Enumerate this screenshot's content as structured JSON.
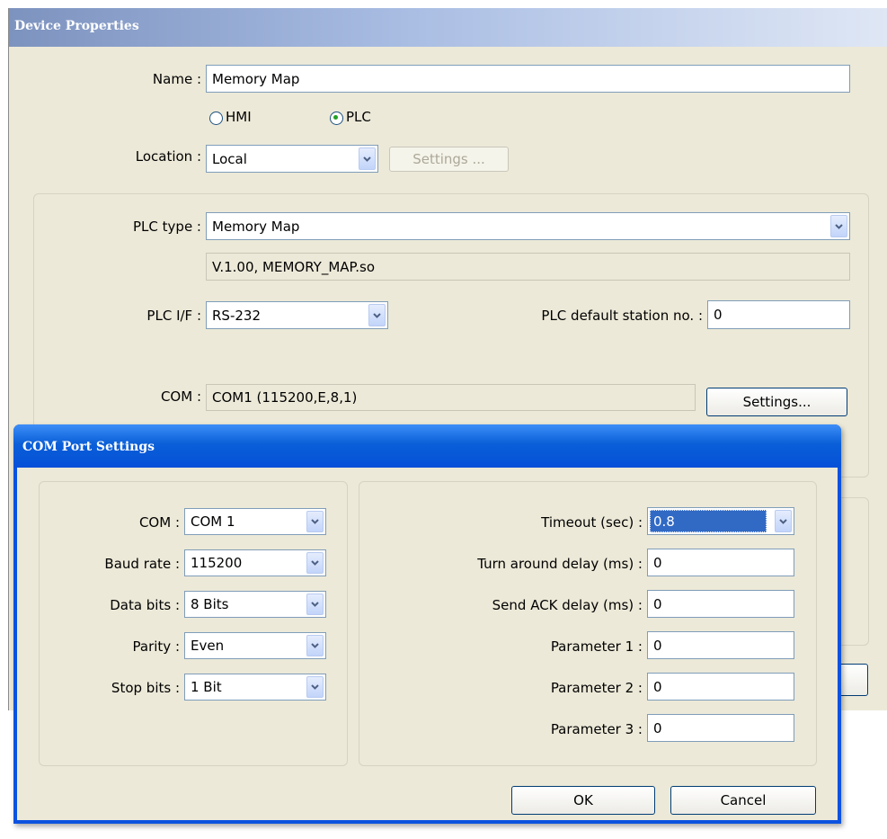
{
  "device": {
    "title": "Device Properties",
    "name_label": "Name :",
    "name_value": "Memory Map",
    "hmi_label": "HMI",
    "plc_label": "PLC",
    "location_label": "Location :",
    "location_value": "Local",
    "location_settings_label": "Settings ...",
    "plc_type_label": "PLC type :",
    "plc_type_value": "Memory Map",
    "plc_info": "V.1.00, MEMORY_MAP.so",
    "plc_if_label": "PLC I/F :",
    "plc_if_value": "RS-232",
    "station_label": "PLC default station no. :",
    "station_value": "0",
    "com_label": "COM :",
    "com_value": "COM1 (115200,E,8,1)",
    "com_settings_label": "Settings..."
  },
  "com_dialog": {
    "title": "COM Port Settings",
    "com_label": "COM :",
    "com_value": "COM 1",
    "baud_label": "Baud rate :",
    "baud_value": "115200",
    "databits_label": "Data bits :",
    "databits_value": "8 Bits",
    "parity_label": "Parity :",
    "parity_value": "Even",
    "stopbits_label": "Stop bits :",
    "stopbits_value": "1 Bit",
    "timeout_label": "Timeout (sec) :",
    "timeout_value": "0.8",
    "turnaround_label": "Turn around delay (ms) :",
    "turnaround_value": "0",
    "sendack_label": "Send ACK delay (ms) :",
    "sendack_value": "0",
    "param1_label": "Parameter 1 :",
    "param1_value": "0",
    "param2_label": "Parameter 2 :",
    "param2_value": "0",
    "param3_label": "Parameter 3 :",
    "param3_value": "0",
    "ok_label": "OK",
    "cancel_label": "Cancel"
  },
  "icons": {
    "cursor": "hand-pointer-icon",
    "dropdown": "chevron-down-icon"
  },
  "colors": {
    "title_bar": "#0a5fd8",
    "dialog_bg": "#ece9d8",
    "selection": "#316ac5"
  }
}
